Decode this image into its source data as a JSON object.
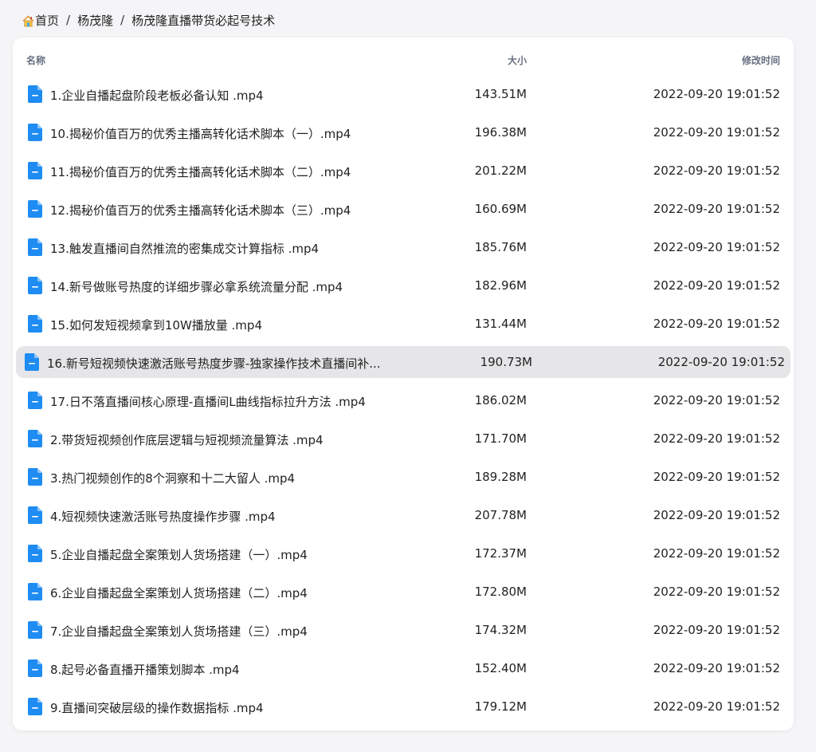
{
  "breadcrumb": {
    "home_icon": "home-icon",
    "items": [
      "首页",
      "杨茂隆",
      "杨茂隆直播带货必起号技术"
    ],
    "separator": "/"
  },
  "table": {
    "headers": {
      "name": "名称",
      "size": "大小",
      "time": "修改时间"
    },
    "file_icon": "file-icon",
    "accent_color": "#1e8cf2",
    "hover_row_index": 7,
    "rows": [
      {
        "name": "1.企业自播起盘阶段老板必备认知 .mp4",
        "size": "143.51M",
        "time": "2022-09-20 19:01:52"
      },
      {
        "name": "10.揭秘价值百万的优秀主播高转化话术脚本（一）.mp4",
        "size": "196.38M",
        "time": "2022-09-20 19:01:52"
      },
      {
        "name": "11.揭秘价值百万的优秀主播高转化话术脚本（二）.mp4",
        "size": "201.22M",
        "time": "2022-09-20 19:01:52"
      },
      {
        "name": "12.揭秘价值百万的优秀主播高转化话术脚本（三）.mp4",
        "size": "160.69M",
        "time": "2022-09-20 19:01:52"
      },
      {
        "name": "13.触发直播间自然推流的密集成交计算指标 .mp4",
        "size": "185.76M",
        "time": "2022-09-20 19:01:52"
      },
      {
        "name": "14.新号做账号热度的详细步骤必拿系统流量分配 .mp4",
        "size": "182.96M",
        "time": "2022-09-20 19:01:52"
      },
      {
        "name": "15.如何发短视频拿到10W播放量 .mp4",
        "size": "131.44M",
        "time": "2022-09-20 19:01:52"
      },
      {
        "name": "16.新号短视频快速激活账号热度步骤-独家操作技术直播间补...",
        "size": "190.73M",
        "time": "2022-09-20 19:01:52"
      },
      {
        "name": "17.日不落直播间核心原理-直播间L曲线指标拉升方法 .mp4",
        "size": "186.02M",
        "time": "2022-09-20 19:01:52"
      },
      {
        "name": "2.带货短视频创作底层逻辑与短视频流量算法 .mp4",
        "size": "171.70M",
        "time": "2022-09-20 19:01:52"
      },
      {
        "name": "3.热门视频创作的8个洞察和十二大留人 .mp4",
        "size": "189.28M",
        "time": "2022-09-20 19:01:52"
      },
      {
        "name": "4.短视频快速激活账号热度操作步骤 .mp4",
        "size": "207.78M",
        "time": "2022-09-20 19:01:52"
      },
      {
        "name": "5.企业自播起盘全案策划人货场搭建（一）.mp4",
        "size": "172.37M",
        "time": "2022-09-20 19:01:52"
      },
      {
        "name": "6.企业自播起盘全案策划人货场搭建（二）.mp4",
        "size": "172.80M",
        "time": "2022-09-20 19:01:52"
      },
      {
        "name": "7.企业自播起盘全案策划人货场搭建（三）.mp4",
        "size": "174.32M",
        "time": "2022-09-20 19:01:52"
      },
      {
        "name": "8.起号必备直播开播策划脚本 .mp4",
        "size": "152.40M",
        "time": "2022-09-20 19:01:52"
      },
      {
        "name": "9.直播间突破层级的操作数据指标 .mp4",
        "size": "179.12M",
        "time": "2022-09-20 19:01:52"
      }
    ]
  }
}
